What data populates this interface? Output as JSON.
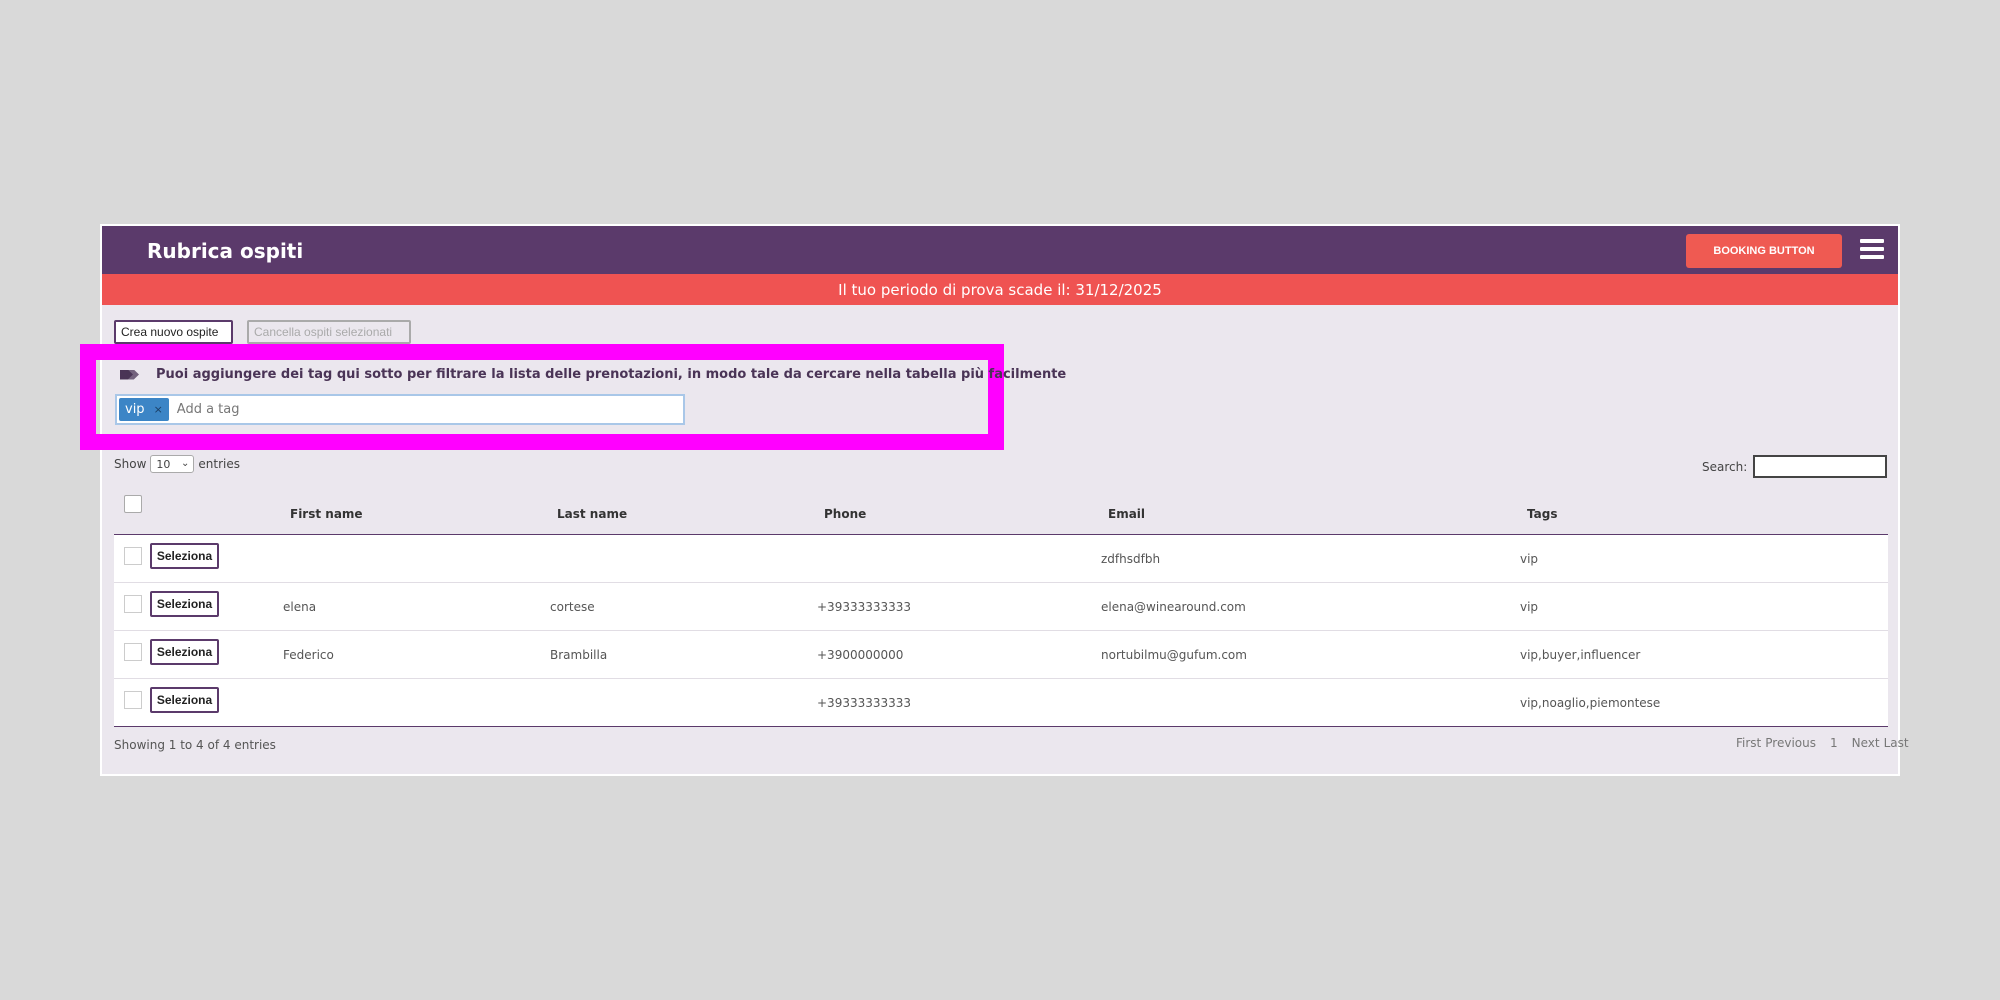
{
  "header": {
    "title": "Rubrica ospiti",
    "booking_button": "BOOKING BUTTON",
    "menu_icon": "hamburger-icon"
  },
  "trial_banner": "Il tuo periodo di prova scade il: 31/12/2025",
  "actions": {
    "create": "Crea nuovo ospite",
    "delete": "Cancella ospiti selezionati"
  },
  "tag_filter": {
    "icon": "tags-icon",
    "info": "Puoi aggiungere dei tag qui sotto per filtrare la lista delle prenotazioni, in modo tale da cercare nella tabella più facilmente",
    "tag": "vip",
    "remove": "×",
    "placeholder": "Add a tag"
  },
  "entries": {
    "show": "Show",
    "value": "10",
    "suffix": "entries"
  },
  "search": {
    "label": "Search:",
    "value": ""
  },
  "table": {
    "headers": [
      "First name",
      "Last name",
      "Phone",
      "Email",
      "Tags"
    ],
    "select_label": "Seleziona",
    "rows": [
      {
        "first": "",
        "last": "",
        "phone": "",
        "email": "zdfhsdfbh",
        "tags": "vip"
      },
      {
        "first": "elena",
        "last": "cortese",
        "phone": "+39333333333",
        "email": "elena@winearound.com",
        "tags": "vip"
      },
      {
        "first": "Federico",
        "last": "Brambilla",
        "phone": "+3900000000",
        "email": "nortubilmu@gufum.com",
        "tags": "vip,buyer,influencer"
      },
      {
        "first": "",
        "last": "",
        "phone": "+39333333333",
        "email": "",
        "tags": "vip,noaglio,piemontese"
      }
    ]
  },
  "footer": {
    "info": "Showing 1 to 4 of 4 entries",
    "pager": {
      "first": "First",
      "previous": "Previous",
      "page": "1",
      "next": "Next",
      "last": "Last"
    }
  },
  "colors": {
    "header": "#5b3a6b",
    "banner": "#ef5352",
    "booking": "#ef5a52",
    "highlight": "#ff00ff",
    "tag_chip": "#3c85c6"
  }
}
